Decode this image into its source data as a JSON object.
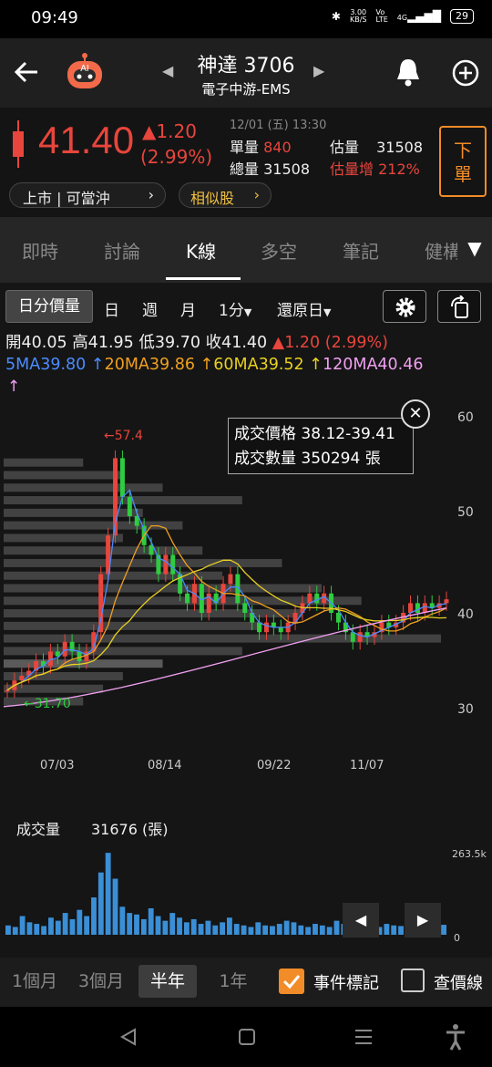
{
  "status_bar": {
    "time": "09:49",
    "net_speed": "3.00\nKB/S",
    "volte": "Vo\nLTE",
    "signal": "4G",
    "battery": "29"
  },
  "header": {
    "stock_name_code": "神達 3706",
    "industry": "電子中游-EMS"
  },
  "quote": {
    "price": "41.40",
    "change": "▲1.20",
    "change_pct": "(2.99%)",
    "datetime": "12/01 (五) 13:30",
    "labels": {
      "volume": "單量",
      "est_volume": "估量",
      "total_volume": "總量",
      "est_increase": "估量增"
    },
    "volume": "840",
    "est_volume": "31508",
    "total_volume": "31508",
    "est_increase": "212%",
    "market_tag": "上市 | 可當沖",
    "similar": "相似股",
    "order_button": "下\n單"
  },
  "tabs": [
    "即時",
    "討論",
    "K線",
    "多空",
    "筆記",
    "健構"
  ],
  "chart_toolbar": {
    "intraday": "日分價量",
    "day": "日",
    "week": "週",
    "month": "月",
    "minute": "1分",
    "restore": "還原日"
  },
  "ohlc": {
    "open": "開40.05",
    "high": "高41.95",
    "low": "低39.70",
    "close": "收41.40",
    "change": "▲1.20",
    "pct": "(2.99%)"
  },
  "ma": {
    "ma5": "5MA39.80",
    "ma20": "20MA39.86",
    "ma60": "60MA39.52",
    "ma120": "120MA40.46",
    "arrow": "↑"
  },
  "tooltip": {
    "price_label": "成交價格",
    "price_value": "38.12-39.41",
    "qty_label": "成交數量",
    "qty_value": "350294 張"
  },
  "volume_panel": {
    "label": "成交量",
    "value": "31676 (張)",
    "max_label": "263.5k",
    "zero_label": "0"
  },
  "periods": [
    "1個月",
    "3個月",
    "半年",
    "1年"
  ],
  "options": {
    "event_mark": "事件標記",
    "price_line": "查價線"
  },
  "colors": {
    "up": "#e8453c",
    "down": "#2ecc40",
    "accent": "#f28c28",
    "ma5": "#4a8cff",
    "ma20": "#f0a020",
    "ma60": "#e8d020",
    "ma120": "#f0a0f0"
  },
  "chart_data": {
    "type": "candlestick",
    "y_ticks": [
      60,
      50,
      40,
      30
    ],
    "x_ticks": [
      "07/03",
      "08/14",
      "09/22",
      "11/07"
    ],
    "high_annotation": "57.4",
    "low_annotation": "31.70",
    "close_series": [
      32,
      33,
      33.5,
      34,
      35,
      34.5,
      36,
      35.5,
      37,
      36,
      35,
      36,
      38,
      44,
      48,
      56,
      52,
      50,
      49,
      47,
      46,
      44,
      46,
      44,
      42,
      41,
      43,
      40,
      42,
      41,
      43,
      44,
      41,
      40,
      39,
      38,
      39,
      38.5,
      38,
      39,
      40,
      41,
      42,
      41,
      42,
      40,
      39,
      38,
      37,
      38,
      37.5,
      38,
      39,
      38.5,
      39,
      40,
      41,
      40,
      41,
      40.5,
      41,
      41.4
    ],
    "volume_series": [
      30,
      25,
      60,
      40,
      35,
      28,
      55,
      45,
      70,
      50,
      80,
      60,
      120,
      200,
      263,
      180,
      90,
      70,
      65,
      50,
      85,
      60,
      45,
      70,
      55,
      40,
      50,
      35,
      45,
      30,
      40,
      55,
      35,
      30,
      25,
      40,
      30,
      28,
      35,
      45,
      40,
      30,
      25,
      35,
      30,
      25,
      45,
      35,
      30,
      25,
      30,
      20,
      25,
      35,
      30,
      28,
      25,
      30,
      35,
      25,
      30,
      32
    ],
    "price_profile": [
      4,
      6,
      8,
      12,
      7,
      9,
      6,
      10,
      14,
      11,
      16,
      18,
      15,
      13,
      22,
      12,
      8,
      6,
      5,
      4
    ]
  }
}
